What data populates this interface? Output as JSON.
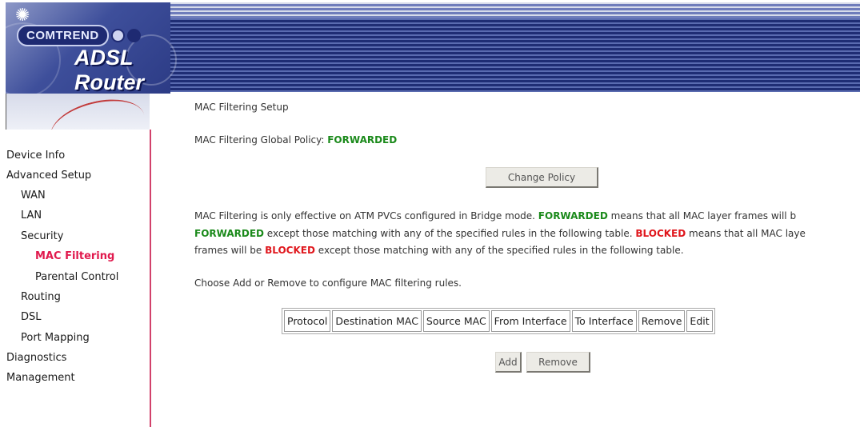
{
  "header": {
    "brand": "COMTREND",
    "product": "ADSL Router",
    "logo_icon": "star-icon"
  },
  "sidebar": {
    "items": [
      {
        "label": "Device Info"
      },
      {
        "label": "Advanced Setup"
      },
      {
        "label": "WAN"
      },
      {
        "label": "LAN"
      },
      {
        "label": "Security"
      },
      {
        "label": "MAC Filtering",
        "active": true
      },
      {
        "label": "Parental Control"
      },
      {
        "label": "Routing"
      },
      {
        "label": "DSL"
      },
      {
        "label": "Port Mapping"
      },
      {
        "label": "Diagnostics"
      },
      {
        "label": "Management"
      }
    ],
    "active_color": "#e0194d",
    "border_color": "#d2426b"
  },
  "main": {
    "title": "MAC Filtering Setup",
    "policy_label": "MAC Filtering Global Policy: ",
    "policy_value": "FORWARDED",
    "change_policy_button": "Change Policy",
    "description": {
      "p1_a": "MAC Filtering is only effective on ATM PVCs configured in Bridge mode. ",
      "p1_b": "FORWARDED",
      "p1_c": " means that all MAC layer frames will b",
      "p2_a": "FORWARDED",
      "p2_b": " except those matching with any of the specified rules in the following table. ",
      "p2_c": "BLOCKED",
      "p2_d": " means that all MAC laye",
      "p3_a": "frames will be ",
      "p3_b": "BLOCKED",
      "p3_c": " except those matching with any of the specified rules in the following table."
    },
    "instruction": "Choose Add or Remove to configure MAC filtering rules.",
    "table": {
      "columns": [
        "Protocol",
        "Destination MAC",
        "Source MAC",
        "From Interface",
        "To Interface",
        "Remove",
        "Edit"
      ]
    },
    "add_button": "Add",
    "remove_button": "Remove",
    "forwarded_color": "#1b8a1b",
    "blocked_color": "#e0171d"
  }
}
